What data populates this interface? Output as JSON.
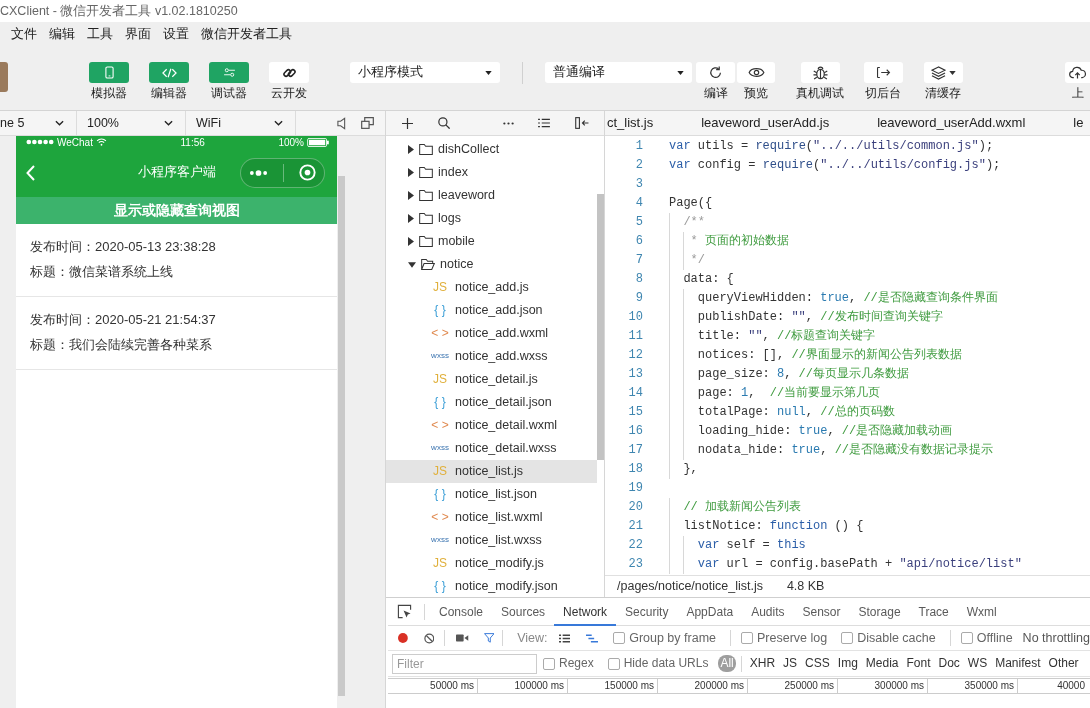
{
  "window": {
    "title": "CXClient - 微信开发者工具 v1.02.1810250"
  },
  "menu": [
    "文件",
    "编辑",
    "工具",
    "界面",
    "设置",
    "微信开发者工具"
  ],
  "toolbar": {
    "view_buttons": [
      {
        "label": "模拟器",
        "kind": "simulator",
        "on": true
      },
      {
        "label": "编辑器",
        "kind": "editor",
        "on": true
      },
      {
        "label": "调试器",
        "kind": "debugger",
        "on": true
      },
      {
        "label": "云开发",
        "kind": "cloud",
        "on": false
      }
    ],
    "mode_select": {
      "value": "小程序模式"
    },
    "compile_select": {
      "value": "普通编译"
    },
    "actions": [
      {
        "label": "编译",
        "kind": "compile"
      },
      {
        "label": "预览",
        "kind": "preview"
      },
      {
        "label": "真机调试",
        "kind": "remote_debug"
      },
      {
        "label": "切后台",
        "kind": "background"
      },
      {
        "label": "清缓存",
        "kind": "clear_cache"
      },
      {
        "label": "上",
        "kind": "upload"
      }
    ]
  },
  "simulator": {
    "device": "ne 5",
    "zoom": "100%",
    "network": "WiFi",
    "status_bar": {
      "carrier": "WeChat",
      "time": "11:56",
      "battery": "100%"
    },
    "nav_title": "小程序客户端",
    "toggle_button": "显示或隐藏查询视图",
    "notices": [
      {
        "time": "发布时间：2020-05-13 23:38:28",
        "title": "标题：微信菜谱系统上线"
      },
      {
        "time": "发布时间：2020-05-21 21:54:37",
        "title": "标题：我们会陆续完善各种菜系"
      }
    ]
  },
  "file_tree": [
    {
      "name": "dishCollect",
      "kind": "folder",
      "expanded": false,
      "selected": false
    },
    {
      "name": "index",
      "kind": "folder",
      "expanded": false,
      "selected": false
    },
    {
      "name": "leaveword",
      "kind": "folder",
      "expanded": false,
      "selected": false
    },
    {
      "name": "logs",
      "kind": "folder",
      "expanded": false,
      "selected": false
    },
    {
      "name": "mobile",
      "kind": "folder",
      "expanded": false,
      "selected": false
    },
    {
      "name": "notice",
      "kind": "folder",
      "expanded": true,
      "selected": false,
      "children": [
        {
          "name": "notice_add.js",
          "kind": "js",
          "tag": "JS",
          "selected": false
        },
        {
          "name": "notice_add.json",
          "kind": "json",
          "tag": "{ }",
          "selected": false
        },
        {
          "name": "notice_add.wxml",
          "kind": "wxml",
          "tag": "< >",
          "selected": false
        },
        {
          "name": "notice_add.wxss",
          "kind": "wxss",
          "tag": "wxss",
          "selected": false
        },
        {
          "name": "notice_detail.js",
          "kind": "js",
          "tag": "JS",
          "selected": false
        },
        {
          "name": "notice_detail.json",
          "kind": "json",
          "tag": "{ }",
          "selected": false
        },
        {
          "name": "notice_detail.wxml",
          "kind": "wxml",
          "tag": "< >",
          "selected": false
        },
        {
          "name": "notice_detail.wxss",
          "kind": "wxss",
          "tag": "wxss",
          "selected": false
        },
        {
          "name": "notice_list.js",
          "kind": "js",
          "tag": "JS",
          "selected": true
        },
        {
          "name": "notice_list.json",
          "kind": "json",
          "tag": "{ }",
          "selected": false
        },
        {
          "name": "notice_list.wxml",
          "kind": "wxml",
          "tag": "< >",
          "selected": false
        },
        {
          "name": "notice_list.wxss",
          "kind": "wxss",
          "tag": "wxss",
          "selected": false
        },
        {
          "name": "notice_modify.js",
          "kind": "js",
          "tag": "JS",
          "selected": false
        },
        {
          "name": "notice_modify.json",
          "kind": "json",
          "tag": "{ }",
          "selected": false
        }
      ]
    }
  ],
  "editor": {
    "tabs": [
      "ct_list.js",
      "leaveword_userAdd.js",
      "leaveword_userAdd.wxml",
      "le"
    ],
    "lines": [
      {
        "number": "1",
        "segments": [
          {
            "text": "var",
            "kind": "kw"
          },
          {
            "text": " utils = ",
            "kind": "plain"
          },
          {
            "text": "require",
            "kind": "fn"
          },
          {
            "text": "(",
            "kind": "plain"
          },
          {
            "text": "\"../../utils/common.js\"",
            "kind": "str"
          },
          {
            "text": ");",
            "kind": "plain"
          }
        ]
      },
      {
        "number": "2",
        "segments": [
          {
            "text": "var",
            "kind": "kw"
          },
          {
            "text": " config = ",
            "kind": "plain"
          },
          {
            "text": "require",
            "kind": "fn"
          },
          {
            "text": "(",
            "kind": "plain"
          },
          {
            "text": "\"../../utils/config.js\"",
            "kind": "str"
          },
          {
            "text": ");",
            "kind": "plain"
          }
        ]
      },
      {
        "number": "3"
      },
      {
        "number": "4",
        "segments": [
          {
            "text": "Page({",
            "kind": "plain"
          }
        ]
      },
      {
        "number": "5",
        "segments": [
          {
            "text": "  /**",
            "kind": "doc"
          }
        ]
      },
      {
        "number": "6",
        "segments": [
          {
            "text": "   * ",
            "kind": "doc"
          },
          {
            "text": "页面的初始数据",
            "kind": "cmt"
          }
        ]
      },
      {
        "number": "7",
        "segments": [
          {
            "text": "   */",
            "kind": "doc"
          }
        ]
      },
      {
        "number": "8",
        "segments": [
          {
            "text": "  data: {",
            "kind": "plain"
          }
        ]
      },
      {
        "number": "9",
        "segments": [
          {
            "text": "    queryViewHidden: ",
            "kind": "plain"
          },
          {
            "text": "true",
            "kind": "val"
          },
          {
            "text": ", ",
            "kind": "plain"
          },
          {
            "text": "//是否隐藏查询条件界面",
            "kind": "cmt"
          }
        ]
      },
      {
        "number": "10",
        "segments": [
          {
            "text": "    publishDate: ",
            "kind": "plain"
          },
          {
            "text": "\"\"",
            "kind": "str"
          },
          {
            "text": ", ",
            "kind": "plain"
          },
          {
            "text": "//发布时间查询关键字",
            "kind": "cmt"
          }
        ]
      },
      {
        "number": "11",
        "segments": [
          {
            "text": "    title: ",
            "kind": "plain"
          },
          {
            "text": "\"\"",
            "kind": "str"
          },
          {
            "text": ", ",
            "kind": "plain"
          },
          {
            "text": "//标题查询关键字",
            "kind": "cmt"
          }
        ]
      },
      {
        "number": "12",
        "segments": [
          {
            "text": "    notices: [], ",
            "kind": "plain"
          },
          {
            "text": "//界面显示的新闻公告列表数据",
            "kind": "cmt"
          }
        ]
      },
      {
        "number": "13",
        "segments": [
          {
            "text": "    page_size: ",
            "kind": "plain"
          },
          {
            "text": "8",
            "kind": "val"
          },
          {
            "text": ", ",
            "kind": "plain"
          },
          {
            "text": "//每页显示几条数据",
            "kind": "cmt"
          }
        ]
      },
      {
        "number": "14",
        "segments": [
          {
            "text": "    page: ",
            "kind": "plain"
          },
          {
            "text": "1",
            "kind": "val"
          },
          {
            "text": ",  ",
            "kind": "plain"
          },
          {
            "text": "//当前要显示第几页",
            "kind": "cmt"
          }
        ]
      },
      {
        "number": "15",
        "segments": [
          {
            "text": "    totalPage: ",
            "kind": "plain"
          },
          {
            "text": "null",
            "kind": "val"
          },
          {
            "text": ", ",
            "kind": "plain"
          },
          {
            "text": "//总的页码数",
            "kind": "cmt"
          }
        ]
      },
      {
        "number": "16",
        "segments": [
          {
            "text": "    loading_hide: ",
            "kind": "plain"
          },
          {
            "text": "true",
            "kind": "val"
          },
          {
            "text": ", ",
            "kind": "plain"
          },
          {
            "text": "//是否隐藏加载动画",
            "kind": "cmt"
          }
        ]
      },
      {
        "number": "17",
        "segments": [
          {
            "text": "    nodata_hide: ",
            "kind": "plain"
          },
          {
            "text": "true",
            "kind": "val"
          },
          {
            "text": ", ",
            "kind": "plain"
          },
          {
            "text": "//是否隐藏没有数据记录提示",
            "kind": "cmt"
          }
        ]
      },
      {
        "number": "18",
        "segments": [
          {
            "text": "  },",
            "kind": "plain"
          }
        ]
      },
      {
        "number": "19"
      },
      {
        "number": "20",
        "segments": [
          {
            "text": "  // 加载新闻公告列表",
            "kind": "cmt"
          }
        ]
      },
      {
        "number": "21",
        "segments": [
          {
            "text": "  listNotice: ",
            "kind": "plain"
          },
          {
            "text": "function",
            "kind": "kw"
          },
          {
            "text": " () {",
            "kind": "plain"
          }
        ]
      },
      {
        "number": "22",
        "segments": [
          {
            "text": "    var",
            "kind": "kw"
          },
          {
            "text": " self = ",
            "kind": "plain"
          },
          {
            "text": "this",
            "kind": "kw"
          }
        ]
      },
      {
        "number": "23",
        "segments": [
          {
            "text": "    var",
            "kind": "kw"
          },
          {
            "text": " url = config.basePath + ",
            "kind": "plain"
          },
          {
            "text": "\"api/notice/list\"",
            "kind": "str"
          }
        ]
      }
    ],
    "status": {
      "path": "/pages/notice/notice_list.js",
      "size": "4.8 KB"
    }
  },
  "devtools": {
    "tabs": [
      {
        "label": "Console",
        "selected": false
      },
      {
        "label": "Sources",
        "selected": false
      },
      {
        "label": "Network",
        "selected": true
      },
      {
        "label": "Security",
        "selected": false
      },
      {
        "label": "AppData",
        "selected": false
      },
      {
        "label": "Audits",
        "selected": false
      },
      {
        "label": "Sensor",
        "selected": false
      },
      {
        "label": "Storage",
        "selected": false
      },
      {
        "label": "Trace",
        "selected": false
      },
      {
        "label": "Wxml",
        "selected": false
      }
    ],
    "recording": true,
    "filter_on": true,
    "view_label": "View:",
    "view_modes": [
      {
        "kind": "list",
        "selected": false
      },
      {
        "kind": "waterfall",
        "selected": true
      }
    ],
    "option_groups": [
      {
        "options": [
          {
            "label": "Group by frame",
            "checked": false
          }
        ]
      },
      {
        "options": [
          {
            "label": "Preserve log",
            "checked": false
          },
          {
            "label": "Disable cache",
            "checked": false
          }
        ]
      },
      {
        "options": [
          {
            "label": "Offline",
            "checked": false
          }
        ]
      }
    ],
    "throttling": "No throttling",
    "filter": {
      "placeholder": "Filter"
    },
    "filter_options": [
      {
        "label": "Regex",
        "checked": false
      },
      {
        "label": "Hide data URLs",
        "checked": false
      }
    ],
    "types": [
      {
        "label": "All",
        "selected": true
      },
      {
        "label": "XHR",
        "selected": false
      },
      {
        "label": "JS",
        "selected": false
      },
      {
        "label": "CSS",
        "selected": false
      },
      {
        "label": "Img",
        "selected": false
      },
      {
        "label": "Media",
        "selected": false
      },
      {
        "label": "Font",
        "selected": false
      },
      {
        "label": "Doc",
        "selected": false
      },
      {
        "label": "WS",
        "selected": false
      },
      {
        "label": "Manifest",
        "selected": false
      },
      {
        "label": "Other",
        "selected": false
      }
    ],
    "timeline": [
      "50000 ms",
      "100000 ms",
      "150000 ms",
      "200000 ms",
      "250000 ms",
      "300000 ms",
      "350000 ms",
      "40000"
    ]
  }
}
